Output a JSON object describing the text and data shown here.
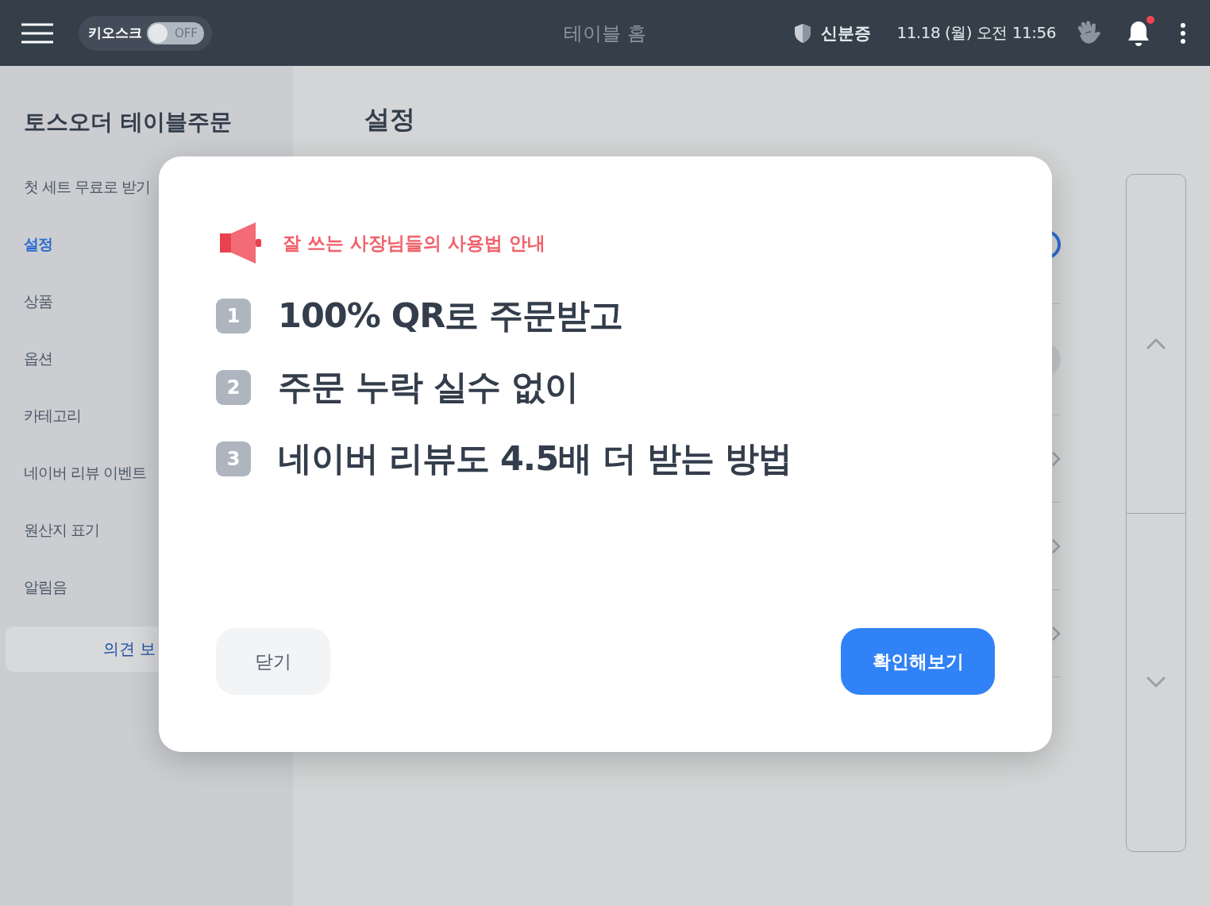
{
  "top_bar": {
    "kiosk": {
      "label": "키오스크",
      "on": false,
      "state_text": "OFF"
    },
    "title": "테이블 홈",
    "id_check": "신분증",
    "datetime": "11.18 (월) 오전 11:56",
    "notification_dot": true
  },
  "sidebar": {
    "title": "토스오더 테이블주문",
    "items": [
      {
        "label": "첫 세트 무료로 받기",
        "selected": false
      },
      {
        "label": "설정",
        "selected": true
      },
      {
        "label": "상품",
        "selected": false
      },
      {
        "label": "옵션",
        "selected": false
      },
      {
        "label": "카테고리",
        "selected": false
      },
      {
        "label": "네이버 리뷰 이벤트",
        "selected": false
      },
      {
        "label": "원산지 표기",
        "selected": false
      },
      {
        "label": "알림음",
        "selected": false
      }
    ],
    "feedback_button": "의견 보"
  },
  "page": {
    "title": "설정",
    "rows": [
      {
        "kind": "radio",
        "selected": true
      },
      {
        "kind": "toggle",
        "on": false
      },
      {
        "kind": "link"
      },
      {
        "kind": "link"
      },
      {
        "kind": "link"
      }
    ]
  },
  "dialog": {
    "heading": "잘 쓰는 사장님들의 사용법 안내",
    "steps": [
      {
        "number": "1",
        "text": "100% QR로 주문받고"
      },
      {
        "number": "2",
        "text": "주문 누락 실수 없이"
      },
      {
        "number": "3",
        "text": "네이버 리뷰도 4.5배 더 받는 방법"
      }
    ],
    "buttons": [
      {
        "label": "닫기",
        "kind": "secondary"
      },
      {
        "label": "확인해보기",
        "kind": "primary"
      }
    ]
  }
}
